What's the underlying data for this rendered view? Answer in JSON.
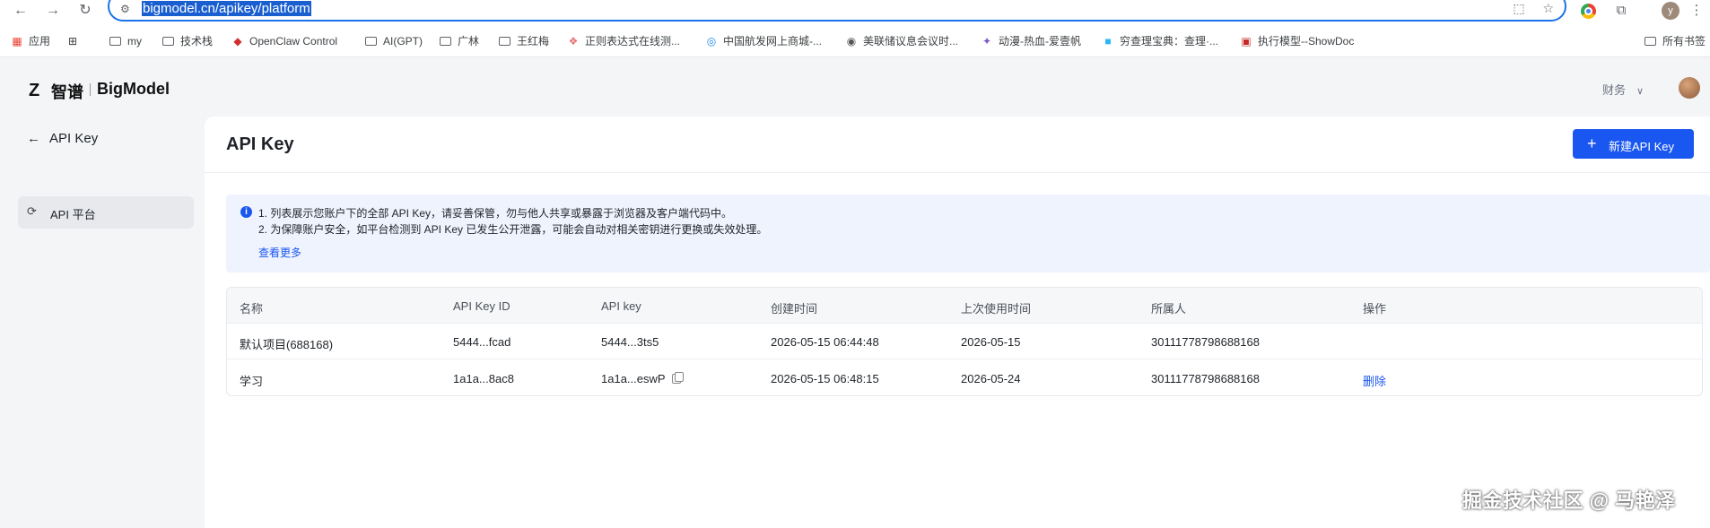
{
  "browser": {
    "url": "bigmodel.cn/apikey/platform",
    "profile_initial": "y",
    "bookmarks": [
      {
        "label": "应用",
        "icon": "apps-grid-icon"
      },
      {
        "label": "",
        "icon": "grid-icon"
      },
      {
        "label": "my",
        "icon": "folder-icon"
      },
      {
        "label": "技术栈",
        "icon": "folder-icon"
      },
      {
        "label": "OpenClaw Control",
        "icon": "openclaw-icon"
      },
      {
        "label": "AI(GPT)",
        "icon": "folder-icon"
      },
      {
        "label": "广林",
        "icon": "folder-icon"
      },
      {
        "label": "王红梅",
        "icon": "folder-icon"
      },
      {
        "label": "正则表达式在线测...",
        "icon": "regex-icon"
      },
      {
        "label": "中国航发网上商城-...",
        "icon": "globe-icon"
      },
      {
        "label": "美联储议息会议时...",
        "icon": "globe-icon"
      },
      {
        "label": "动漫-热血-爱壹帆",
        "icon": "anime-icon"
      },
      {
        "label": "穷查理宝典：查理·...",
        "icon": "book-icon"
      },
      {
        "label": "执行模型--ShowDoc",
        "icon": "showdoc-icon"
      },
      {
        "label": "所有书签",
        "icon": "folder-icon"
      }
    ]
  },
  "header": {
    "logo_mark": "Z",
    "logo_cn": "智谱",
    "logo_en": "BigModel",
    "finance_label": "财务"
  },
  "sidebar": {
    "back_label": "API Key",
    "items": [
      {
        "label": "API 平台",
        "active": true
      }
    ]
  },
  "main": {
    "title": "API Key",
    "new_button": "新建API Key",
    "notice": {
      "line1": "1. 列表展示您账户下的全部 API Key，请妥善保管，勿与他人共享或暴露于浏览器及客户端代码中。",
      "line2": "2. 为保障账户安全，如平台检测到 API Key 已发生公开泄露，可能会自动对相关密钥进行更换或失效处理。",
      "more_link": "查看更多"
    },
    "table": {
      "headers": [
        "名称",
        "API Key ID",
        "API key",
        "创建时间",
        "上次使用时间",
        "所属人",
        "操作"
      ],
      "rows": [
        {
          "name": "默认项目(688168)",
          "key_id": "5444...fcad",
          "api_key": "5444...3ts5",
          "created": "2026-05-15 06:44:48",
          "last_used": "2026-05-15",
          "owner": "30111778798688168",
          "action": ""
        },
        {
          "name": "学习",
          "key_id": "1a1a...8ac8",
          "api_key": "1a1a...eswP",
          "created": "2026-05-15 06:48:15",
          "last_used": "2026-05-24",
          "owner": "30111778798688168",
          "action": "删除"
        }
      ]
    }
  },
  "watermark": "掘金技术社区 @ 马艳泽",
  "colors": {
    "accent": "#1a56f0",
    "sidebar_bg": "#f4f5f7",
    "notice_bg": "#eef3fd"
  }
}
